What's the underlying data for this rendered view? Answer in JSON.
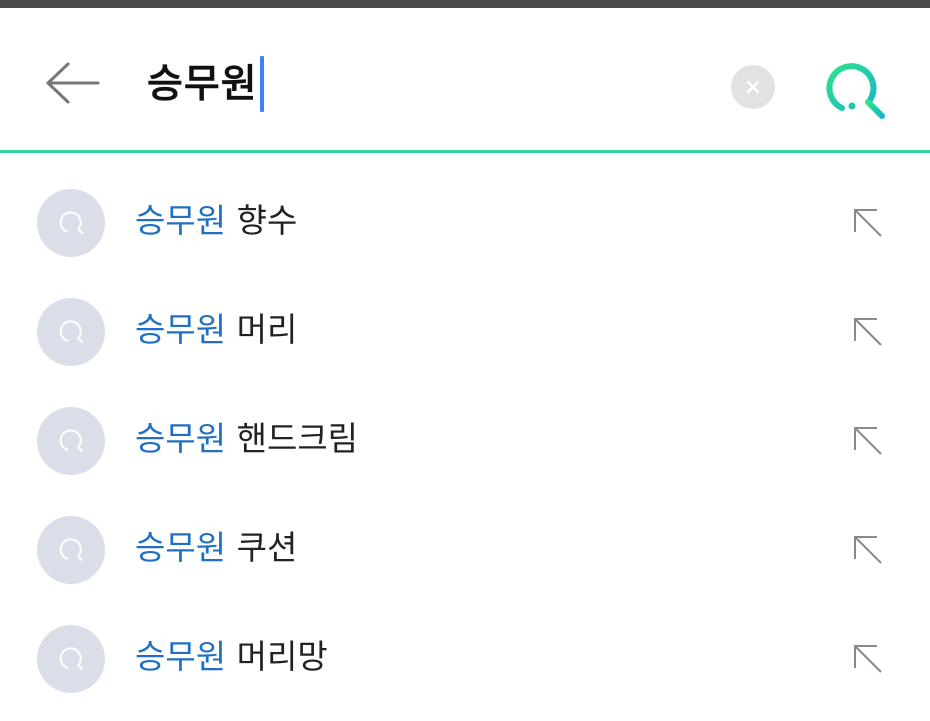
{
  "header": {
    "back_icon": "arrow-left-icon",
    "query": "승무원",
    "clear_icon": "close-icon",
    "search_icon": "search-icon",
    "accent_color": "#35d39a",
    "caret_color": "#3b82f6"
  },
  "suggestions": [
    {
      "match": "승무원",
      "rest": "향수"
    },
    {
      "match": "승무원",
      "rest": "머리"
    },
    {
      "match": "승무원",
      "rest": "핸드크림"
    },
    {
      "match": "승무원",
      "rest": "쿠션"
    },
    {
      "match": "승무원",
      "rest": "머리망"
    }
  ],
  "suggestion_icons": {
    "leading": "search-history-icon",
    "trailing": "arrow-up-left-icon"
  },
  "colors": {
    "match_text": "#1f6fc3",
    "rest_text": "#222222",
    "icon_bg": "#d9dee9"
  }
}
